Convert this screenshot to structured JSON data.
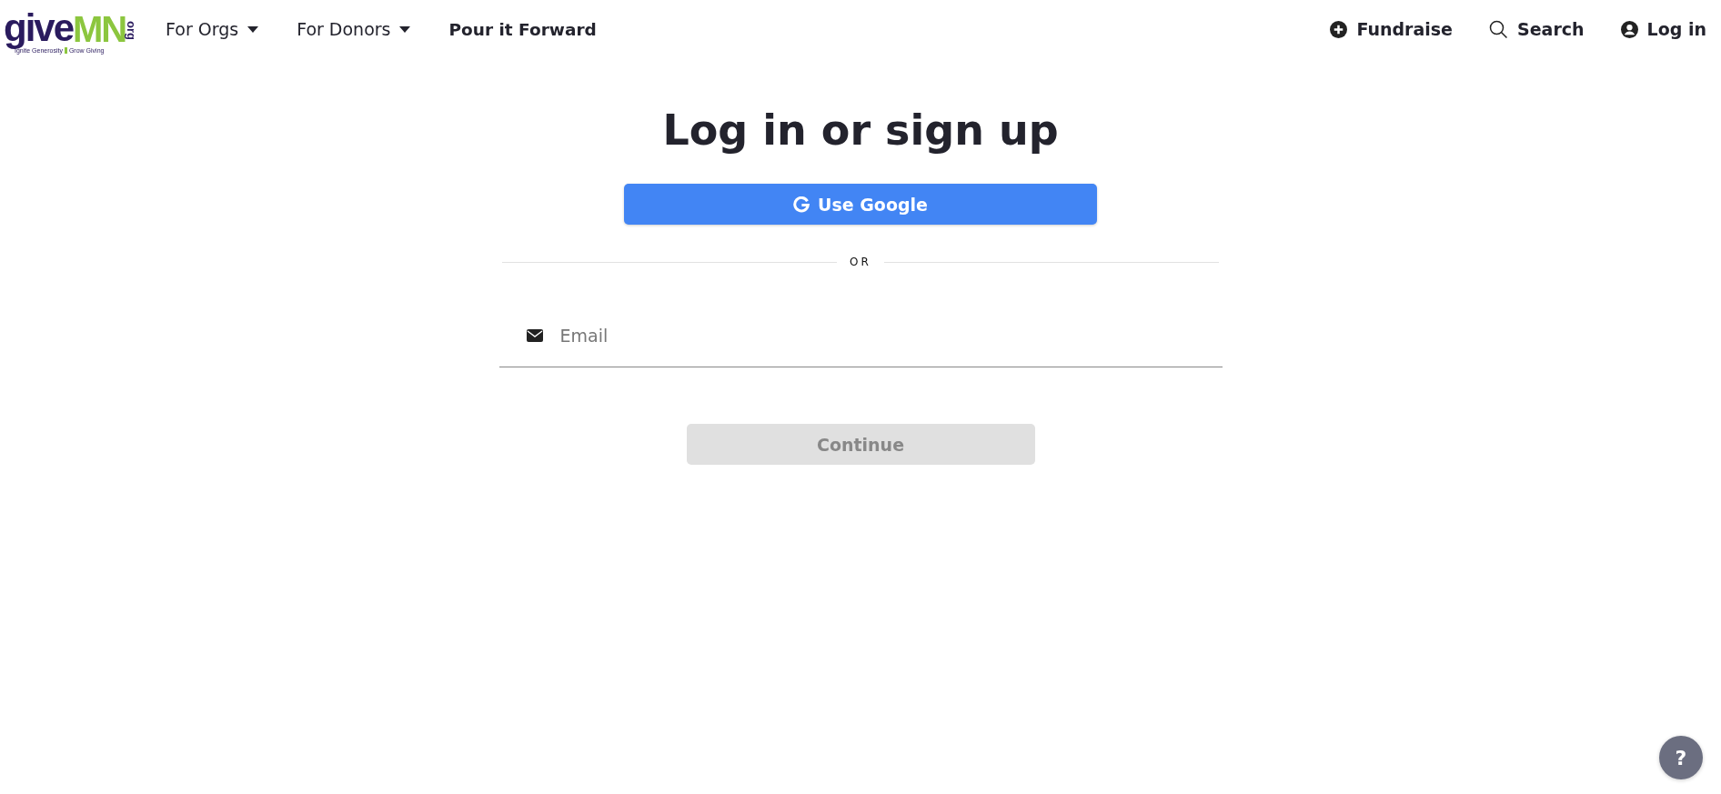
{
  "logo": {
    "word": "give",
    "accent": "MN",
    "suffix": "org",
    "tagline_left": "Ignite Generosity",
    "tagline_right": "Grow Giving"
  },
  "nav": [
    {
      "label": "For Orgs",
      "dropdown": true
    },
    {
      "label": "For Donors",
      "dropdown": true
    },
    {
      "label": "Pour it Forward",
      "dropdown": false
    }
  ],
  "actions": [
    {
      "kind": "plus",
      "label": "Fundraise"
    },
    {
      "kind": "search",
      "label": "Search"
    },
    {
      "kind": "user",
      "label": "Log in"
    }
  ],
  "title": "Log in or sign up",
  "google_button": "Use Google",
  "divider": "OR",
  "email": {
    "placeholder": "Email"
  },
  "continue": {
    "label": "Continue",
    "disabled": true
  },
  "help": "?"
}
